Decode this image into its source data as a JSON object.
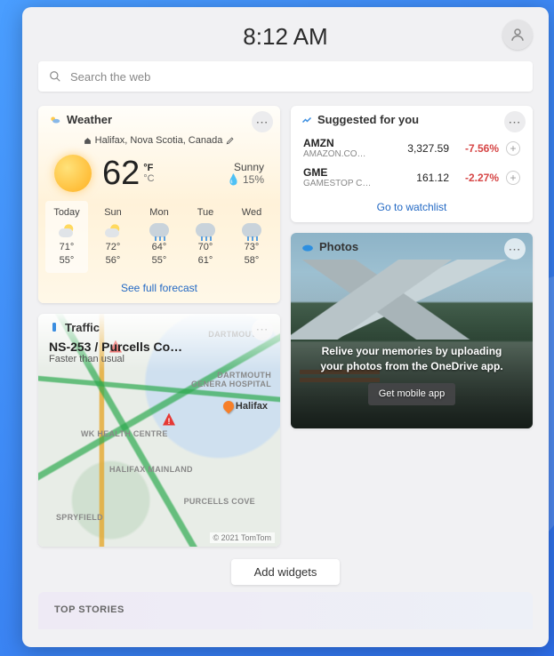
{
  "header": {
    "time": "8:12 AM"
  },
  "search": {
    "placeholder": "Search the web"
  },
  "weather": {
    "title": "Weather",
    "location": "Halifax, Nova Scotia, Canada",
    "temp": "62",
    "unit_f": "°F",
    "unit_c": "°C",
    "condition": "Sunny",
    "humidity": "15%",
    "footer": "See full forecast",
    "forecast": [
      {
        "day": "Today",
        "icon": "sunny",
        "hi": "71°",
        "lo": "55°"
      },
      {
        "day": "Sun",
        "icon": "sunny",
        "hi": "72°",
        "lo": "56°"
      },
      {
        "day": "Mon",
        "icon": "rain",
        "hi": "64°",
        "lo": "55°"
      },
      {
        "day": "Tue",
        "icon": "rain",
        "hi": "70°",
        "lo": "61°"
      },
      {
        "day": "Wed",
        "icon": "rain",
        "hi": "73°",
        "lo": "58°"
      }
    ]
  },
  "traffic": {
    "title": "Traffic",
    "route": "NS-253 / Purcells Co…",
    "status": "Faster than usual",
    "city": "Halifax",
    "copyright": "© 2021 TomTom",
    "labels": {
      "dartmouth": "Dartmouth",
      "hospital1": "Dartmouth Genera Hospital",
      "hospital2": "WK Health Centre",
      "mainland": "HALIFAX MAINLAND",
      "spryfield": "SPRYFIELD",
      "purcells": "PURCELLS COVE"
    }
  },
  "stocks": {
    "title": "Suggested for you",
    "footer": "Go to watchlist",
    "items": [
      {
        "symbol": "AMZN",
        "name": "AMAZON.CO…",
        "price": "3,327.59",
        "change": "-7.56%"
      },
      {
        "symbol": "GME",
        "name": "GAMESTOP C…",
        "price": "161.12",
        "change": "-2.27%"
      }
    ]
  },
  "photos": {
    "title": "Photos",
    "caption": "Relive your memories by uploading your photos from the OneDrive app.",
    "button": "Get mobile app"
  },
  "buttons": {
    "add_widgets": "Add widgets"
  },
  "sections": {
    "top_stories": "TOP STORIES"
  }
}
